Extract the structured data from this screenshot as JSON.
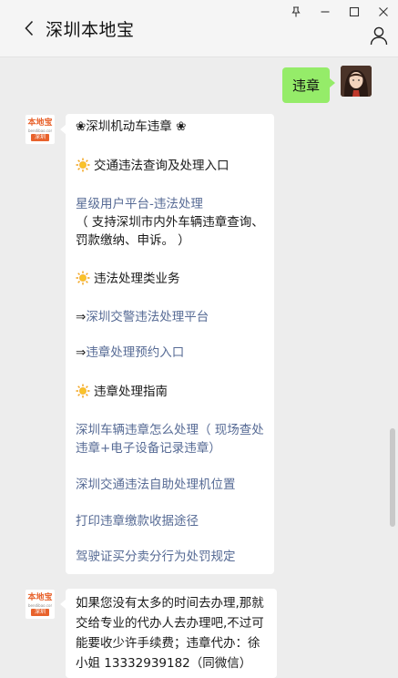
{
  "window": {
    "title": "深圳本地宝"
  },
  "outgoing": {
    "text": "违章"
  },
  "reply": {
    "heading": "❀深圳机动车违章 ❀",
    "section1_title": "交通违法查询及处理入口",
    "link_star_platform": "星级用户平台-违法处理",
    "desc_line1": "（ 支持深圳市内外车辆违章查询、",
    "desc_line2": "罚款缴纳、申诉。 ）",
    "section2_title": "违法处理类业务",
    "link_police_prefix": "⇒",
    "link_police": "深圳交警违法处理平台",
    "link_appoint_prefix": "⇒",
    "link_appoint": "违章处理预约入口",
    "section3_title": "违章处理指南",
    "guide_line1": "深圳车辆违章怎么处理（ 现场查处",
    "guide_line2": "违章+电子设备记录违章）",
    "link_machine": "深圳交通违法自助处理机位置",
    "link_receipt": "打印违章缴款收据途径",
    "link_license": "驾驶证买分卖分行为处罚规定"
  },
  "reply2": {
    "line1": "如果您没有太多的时间去办理,那就",
    "line2": "交给专业的代办人去办理吧,不过可",
    "line3": "能要收少许手续费；违章代办：徐",
    "line4": "小姐 13332939182（同微信）"
  },
  "bot_avatar": {
    "logo": "本地宝",
    "subtitle": "bendibao.com",
    "city": "深圳"
  },
  "colors": {
    "link": "#576b95",
    "bubble_out": "#95ec69",
    "background": "#ededed",
    "brand": "#e8622c"
  }
}
